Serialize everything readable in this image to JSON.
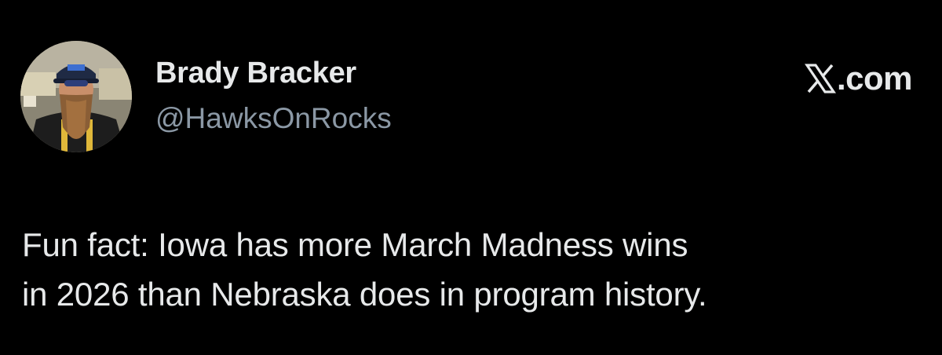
{
  "author": {
    "display_name": "Brady Bracker",
    "handle": "@HawksOnRocks",
    "avatar_icon": "profile-photo-avatar"
  },
  "brand": {
    "icon": "x-logo-icon",
    "label": ".com"
  },
  "tweet": {
    "lines": [
      "Fun fact: Iowa has more March Madness wins",
      "in 2026 than Nebraska does in program history."
    ]
  },
  "colors": {
    "background": "#000000",
    "primary_text": "#e7e9ea",
    "secondary_text": "#8b98a5"
  }
}
